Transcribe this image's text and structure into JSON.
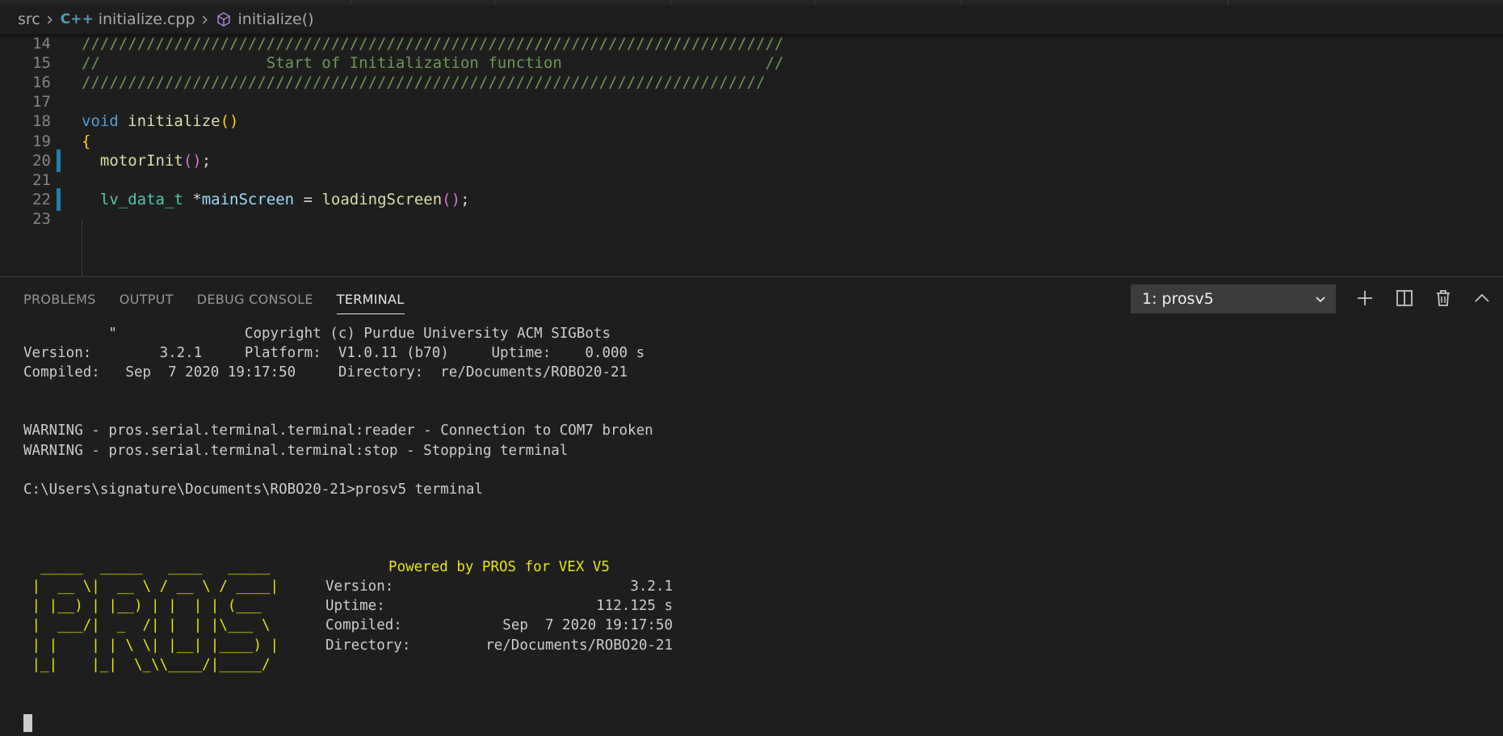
{
  "breadcrumb": {
    "folder": "src",
    "file_icon": "C++",
    "file": "initialize.cpp",
    "symbol_icon": "cube-icon",
    "symbol": "initialize()"
  },
  "editor": {
    "lines": [
      {
        "num": "14",
        "tokens": [
          {
            "t": "////////////////////////////////////////////////////////////////////////////",
            "c": "c-comment"
          }
        ]
      },
      {
        "num": "15",
        "tokens": [
          {
            "t": "//                  Start of Initialization function                      //",
            "c": "c-comment"
          }
        ]
      },
      {
        "num": "16",
        "tokens": [
          {
            "t": "//////////////////////////////////////////////////////////////////////////",
            "c": "c-comment"
          }
        ]
      },
      {
        "num": "17",
        "tokens": []
      },
      {
        "num": "18",
        "tokens": [
          {
            "t": "void",
            "c": "c-kw"
          },
          {
            "t": " ",
            "c": "c-plain"
          },
          {
            "t": "initialize",
            "c": "c-fn"
          },
          {
            "t": "()",
            "c": "c-paren"
          }
        ]
      },
      {
        "num": "19",
        "tokens": [
          {
            "t": "{",
            "c": "c-paren"
          }
        ]
      },
      {
        "num": "20",
        "mark": true,
        "tokens": [
          {
            "t": "  ",
            "c": "c-plain"
          },
          {
            "t": "motorInit",
            "c": "c-fn"
          },
          {
            "t": "()",
            "c": "c-paren2"
          },
          {
            "t": ";",
            "c": "c-plain"
          }
        ]
      },
      {
        "num": "21",
        "tokens": []
      },
      {
        "num": "22",
        "mark": true,
        "tokens": [
          {
            "t": "  ",
            "c": "c-plain"
          },
          {
            "t": "lv_data_t",
            "c": "c-type"
          },
          {
            "t": " *",
            "c": "c-plain"
          },
          {
            "t": "mainScreen",
            "c": "c-var"
          },
          {
            "t": " = ",
            "c": "c-plain"
          },
          {
            "t": "loadingScreen",
            "c": "c-fn"
          },
          {
            "t": "()",
            "c": "c-paren2"
          },
          {
            "t": ";",
            "c": "c-plain"
          }
        ]
      },
      {
        "num": "23",
        "tokens": []
      }
    ]
  },
  "panel": {
    "tabs": [
      "PROBLEMS",
      "OUTPUT",
      "DEBUG CONSOLE",
      "TERMINAL"
    ],
    "active_tab": "TERMINAL",
    "terminal_select": "1: prosv5",
    "icons": [
      "plus-icon",
      "split-icon",
      "trash-icon",
      "chevron-up-icon"
    ]
  },
  "terminal": {
    "lines": [
      {
        "text": "          \"               Copyright (c) Purdue University ACM SIGBots",
        "yellow": false
      },
      {
        "text": "Version:        3.2.1     Platform:  V1.0.11 (b70)     Uptime:    0.000 s",
        "yellow": false
      },
      {
        "text": "Compiled:   Sep  7 2020 19:17:50     Directory:  re/Documents/ROBO20-21",
        "yellow": false
      },
      {
        "text": "",
        "yellow": false
      },
      {
        "text": "",
        "yellow": false
      },
      {
        "text": "WARNING - pros.serial.terminal.terminal:reader - Connection to COM7 broken",
        "yellow": false
      },
      {
        "text": "WARNING - pros.serial.terminal.terminal:stop - Stopping terminal",
        "yellow": false
      },
      {
        "text": "",
        "yellow": false
      },
      {
        "text": "C:\\Users\\signature\\Documents\\ROBO20-21>prosv5 terminal",
        "yellow": false
      },
      {
        "text": "",
        "yellow": false
      },
      {
        "text": "",
        "yellow": false
      },
      {
        "text": "",
        "yellow": false
      },
      {
        "text": "  _____  _____   ____   _____",
        "yellow": true
      },
      {
        "text": " |  __ \\|  __ \\ / __ \\ / ____|",
        "yellow": true
      },
      {
        "text": " | |__) | |__) | |  | | (___",
        "yellow": true
      },
      {
        "text": " |  ___/|  _  /| |  | |\\___ \\",
        "yellow": true
      },
      {
        "text": " | |    | | \\ \\| |__| |____) |",
        "yellow": true
      },
      {
        "text": " |_|    |_|  \\_\\\\____/|_____/",
        "yellow": true
      },
      {
        "text": "",
        "yellow": false
      }
    ],
    "info_title": "Powered by PROS for VEX V5",
    "info_rows": [
      {
        "label": "Version:",
        "value": "3.2.1"
      },
      {
        "label": "Uptime:",
        "value": "112.125 s"
      },
      {
        "label": "Compiled:",
        "value": "Sep  7 2020 19:17:50"
      },
      {
        "label": "Directory:",
        "value": "re/Documents/ROBO20-21"
      }
    ]
  }
}
